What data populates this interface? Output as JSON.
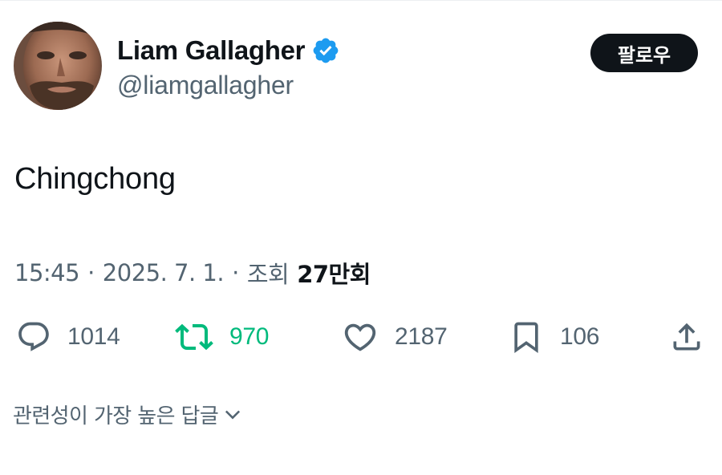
{
  "author": {
    "display_name": "Liam Gallagher",
    "handle": "@liamgallagher",
    "verified": true
  },
  "follow_label": "팔로우",
  "tweet": {
    "text": "Chingchong"
  },
  "meta": {
    "time": "15:45",
    "separator": "·",
    "date": "2025. 7. 1.",
    "views_label": "조회",
    "views_count": "27만회"
  },
  "actions": {
    "replies": "1014",
    "retweets": "970",
    "likes": "2187",
    "bookmarks": "106"
  },
  "replies_sort": {
    "label": "관련성이 가장 높은 답글"
  },
  "colors": {
    "text_primary": "#0f1419",
    "text_secondary": "#536471",
    "verified_blue": "#1d9bf0",
    "retweet_green": "#00ba7c",
    "button_dark": "#0f1419"
  },
  "icons": {
    "verified": "verified-badge-icon",
    "reply": "speech-bubble-icon",
    "retweet": "retweet-arrows-icon",
    "like": "heart-icon",
    "bookmark": "bookmark-icon",
    "share": "share-upload-icon",
    "sort": "chevron-down-icon"
  }
}
